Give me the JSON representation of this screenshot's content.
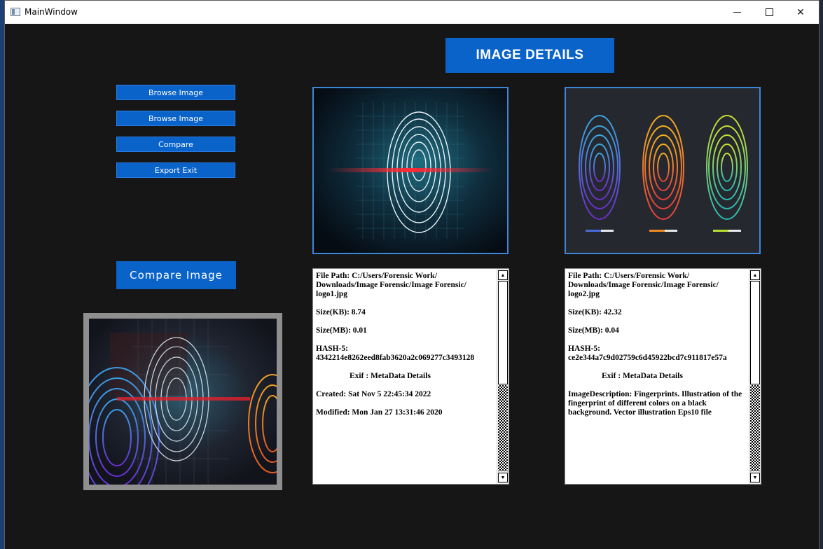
{
  "window": {
    "title": "MainWindow"
  },
  "header": {
    "title": "IMAGE DETAILS"
  },
  "sidebar": {
    "buttons": [
      {
        "label": "Browse Image"
      },
      {
        "label": "Browse Image"
      },
      {
        "label": "Compare"
      },
      {
        "label": "Export  Exit"
      }
    ],
    "compare_image_label": "Compare Image"
  },
  "image_panels": [
    {
      "icon": "fingerprint-scan-image"
    },
    {
      "icon": "three-fingerprints-image"
    }
  ],
  "details": [
    {
      "file_path": "File Path:   C:/Users/Forensic Work/ Downloads/Image Forensic/Image Forensic/ logo1.jpg",
      "size_kb": "Size(KB):   8.74",
      "size_mb": "Size(MB):   0.01",
      "hash": "HASH-5: 4342214e8262eed8fab3620a2c069277c3493128",
      "exif_heading": "Exif :   MetaData Details",
      "line1": "Created:   Sat Nov  5 22:45:34 2022",
      "line2": "Modified:   Mon Jan 27 13:31:46 2020"
    },
    {
      "file_path": "File Path:   C:/Users/Forensic Work/ Downloads/Image Forensic/Image Forensic/ logo2.jpg",
      "size_kb": "Size(KB):   42.32",
      "size_mb": "Size(MB):   0.04",
      "hash": "HASH-5: ce2e344a7c9d02759c6d45922bcd7c911817e57a",
      "exif_heading": "Exif :   MetaData Details",
      "line1": "ImageDescription:   Fingerprints. Illustration of the fingerprint of different colors on a black background. Vector illustration Eps10 file",
      "line2": ""
    }
  ],
  "colors": {
    "accent": "#0a63c9",
    "background": "#161616",
    "frame_border": "#3e86d8"
  }
}
